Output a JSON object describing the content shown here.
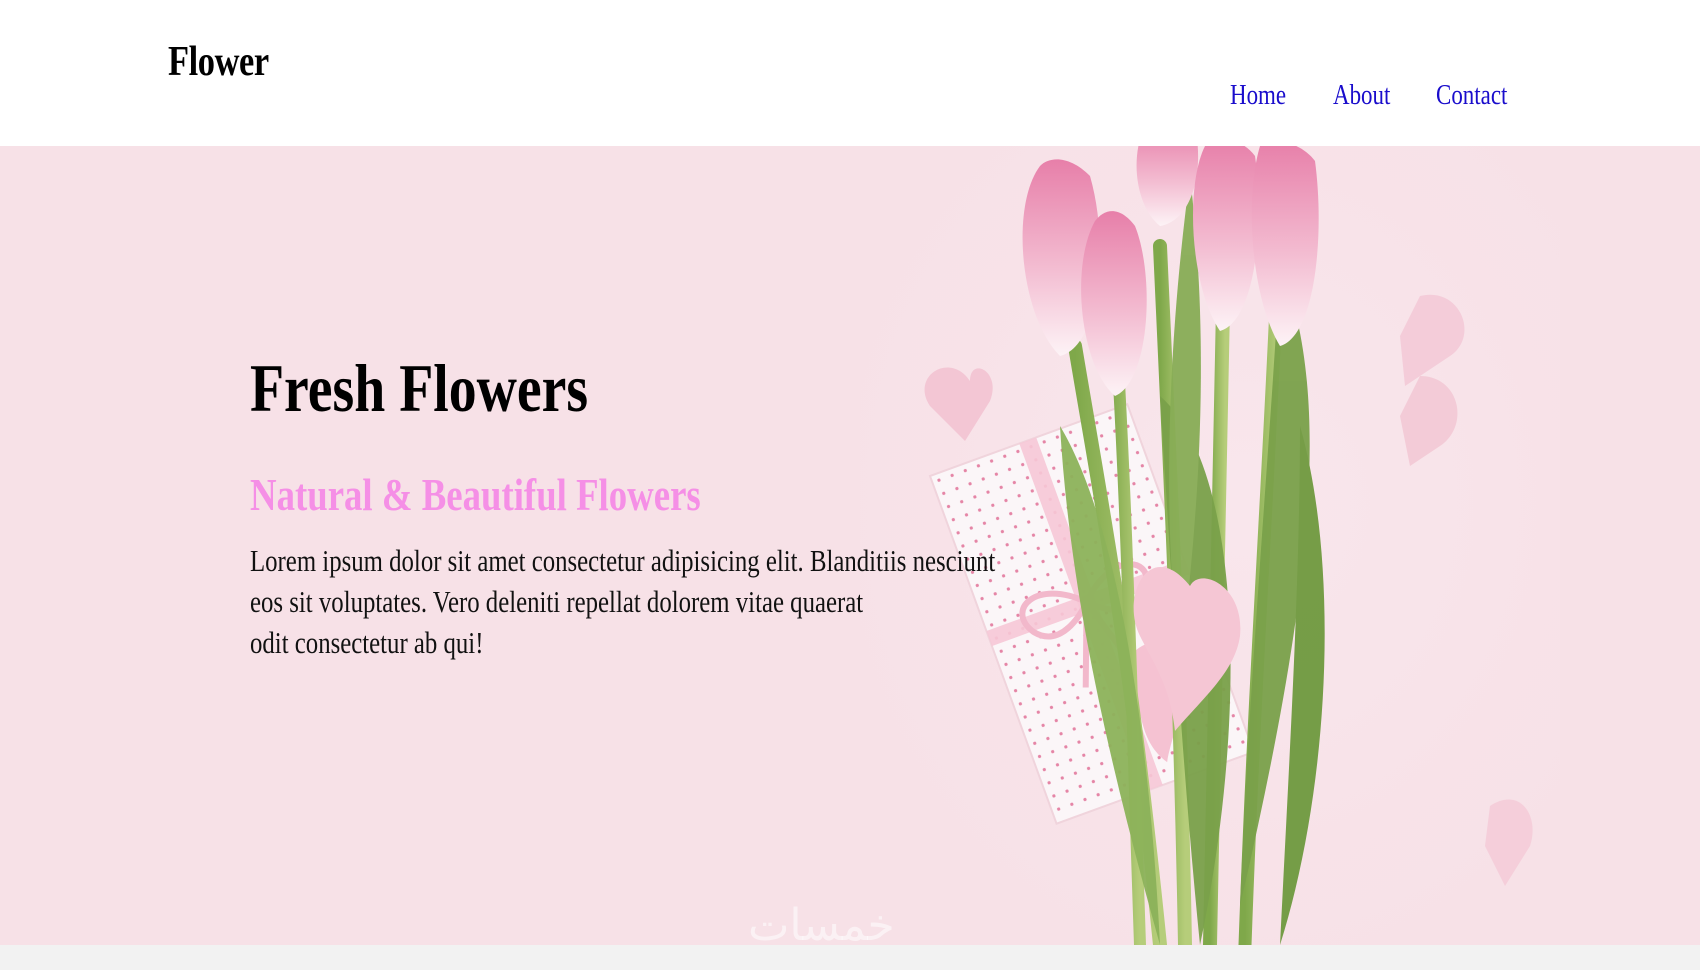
{
  "header": {
    "logo": "Flower",
    "nav": [
      {
        "label": "Home"
      },
      {
        "label": "About"
      },
      {
        "label": "Contact"
      }
    ]
  },
  "hero": {
    "title": "Fresh Flowers",
    "subtitle": "Natural & Beautiful Flowers",
    "body_lines": [
      "Lorem ipsum dolor sit amet consectetur adipisicing elit. Blanditiis nesciunt",
      "eos sit voluptates. Vero deleniti repellat dolorem vitae quaerat",
      "odit consectetur ab qui!"
    ],
    "image": "pink-tulips-gift-hearts-image"
  },
  "watermark": "خمسات",
  "colors": {
    "hero_bg": "#f7e1e7",
    "subtitle": "#f58fe6",
    "nav_link": "#1a0dcc",
    "footer_strip": "#f2f2f2"
  }
}
